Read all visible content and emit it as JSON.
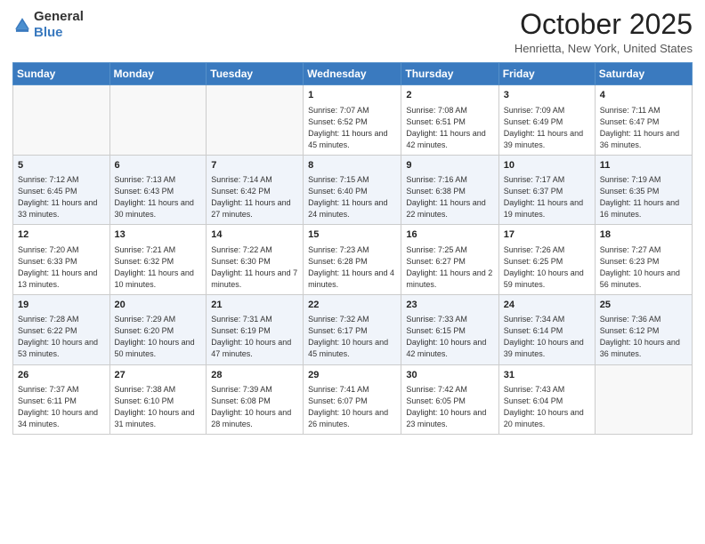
{
  "header": {
    "logo": {
      "general": "General",
      "blue": "Blue"
    },
    "title": "October 2025",
    "location": "Henrietta, New York, United States"
  },
  "weekdays": [
    "Sunday",
    "Monday",
    "Tuesday",
    "Wednesday",
    "Thursday",
    "Friday",
    "Saturday"
  ],
  "weeks": [
    [
      {
        "day": "",
        "info": ""
      },
      {
        "day": "",
        "info": ""
      },
      {
        "day": "",
        "info": ""
      },
      {
        "day": "1",
        "info": "Sunrise: 7:07 AM\nSunset: 6:52 PM\nDaylight: 11 hours and 45 minutes."
      },
      {
        "day": "2",
        "info": "Sunrise: 7:08 AM\nSunset: 6:51 PM\nDaylight: 11 hours and 42 minutes."
      },
      {
        "day": "3",
        "info": "Sunrise: 7:09 AM\nSunset: 6:49 PM\nDaylight: 11 hours and 39 minutes."
      },
      {
        "day": "4",
        "info": "Sunrise: 7:11 AM\nSunset: 6:47 PM\nDaylight: 11 hours and 36 minutes."
      }
    ],
    [
      {
        "day": "5",
        "info": "Sunrise: 7:12 AM\nSunset: 6:45 PM\nDaylight: 11 hours and 33 minutes."
      },
      {
        "day": "6",
        "info": "Sunrise: 7:13 AM\nSunset: 6:43 PM\nDaylight: 11 hours and 30 minutes."
      },
      {
        "day": "7",
        "info": "Sunrise: 7:14 AM\nSunset: 6:42 PM\nDaylight: 11 hours and 27 minutes."
      },
      {
        "day": "8",
        "info": "Sunrise: 7:15 AM\nSunset: 6:40 PM\nDaylight: 11 hours and 24 minutes."
      },
      {
        "day": "9",
        "info": "Sunrise: 7:16 AM\nSunset: 6:38 PM\nDaylight: 11 hours and 22 minutes."
      },
      {
        "day": "10",
        "info": "Sunrise: 7:17 AM\nSunset: 6:37 PM\nDaylight: 11 hours and 19 minutes."
      },
      {
        "day": "11",
        "info": "Sunrise: 7:19 AM\nSunset: 6:35 PM\nDaylight: 11 hours and 16 minutes."
      }
    ],
    [
      {
        "day": "12",
        "info": "Sunrise: 7:20 AM\nSunset: 6:33 PM\nDaylight: 11 hours and 13 minutes."
      },
      {
        "day": "13",
        "info": "Sunrise: 7:21 AM\nSunset: 6:32 PM\nDaylight: 11 hours and 10 minutes."
      },
      {
        "day": "14",
        "info": "Sunrise: 7:22 AM\nSunset: 6:30 PM\nDaylight: 11 hours and 7 minutes."
      },
      {
        "day": "15",
        "info": "Sunrise: 7:23 AM\nSunset: 6:28 PM\nDaylight: 11 hours and 4 minutes."
      },
      {
        "day": "16",
        "info": "Sunrise: 7:25 AM\nSunset: 6:27 PM\nDaylight: 11 hours and 2 minutes."
      },
      {
        "day": "17",
        "info": "Sunrise: 7:26 AM\nSunset: 6:25 PM\nDaylight: 10 hours and 59 minutes."
      },
      {
        "day": "18",
        "info": "Sunrise: 7:27 AM\nSunset: 6:23 PM\nDaylight: 10 hours and 56 minutes."
      }
    ],
    [
      {
        "day": "19",
        "info": "Sunrise: 7:28 AM\nSunset: 6:22 PM\nDaylight: 10 hours and 53 minutes."
      },
      {
        "day": "20",
        "info": "Sunrise: 7:29 AM\nSunset: 6:20 PM\nDaylight: 10 hours and 50 minutes."
      },
      {
        "day": "21",
        "info": "Sunrise: 7:31 AM\nSunset: 6:19 PM\nDaylight: 10 hours and 47 minutes."
      },
      {
        "day": "22",
        "info": "Sunrise: 7:32 AM\nSunset: 6:17 PM\nDaylight: 10 hours and 45 minutes."
      },
      {
        "day": "23",
        "info": "Sunrise: 7:33 AM\nSunset: 6:15 PM\nDaylight: 10 hours and 42 minutes."
      },
      {
        "day": "24",
        "info": "Sunrise: 7:34 AM\nSunset: 6:14 PM\nDaylight: 10 hours and 39 minutes."
      },
      {
        "day": "25",
        "info": "Sunrise: 7:36 AM\nSunset: 6:12 PM\nDaylight: 10 hours and 36 minutes."
      }
    ],
    [
      {
        "day": "26",
        "info": "Sunrise: 7:37 AM\nSunset: 6:11 PM\nDaylight: 10 hours and 34 minutes."
      },
      {
        "day": "27",
        "info": "Sunrise: 7:38 AM\nSunset: 6:10 PM\nDaylight: 10 hours and 31 minutes."
      },
      {
        "day": "28",
        "info": "Sunrise: 7:39 AM\nSunset: 6:08 PM\nDaylight: 10 hours and 28 minutes."
      },
      {
        "day": "29",
        "info": "Sunrise: 7:41 AM\nSunset: 6:07 PM\nDaylight: 10 hours and 26 minutes."
      },
      {
        "day": "30",
        "info": "Sunrise: 7:42 AM\nSunset: 6:05 PM\nDaylight: 10 hours and 23 minutes."
      },
      {
        "day": "31",
        "info": "Sunrise: 7:43 AM\nSunset: 6:04 PM\nDaylight: 10 hours and 20 minutes."
      },
      {
        "day": "",
        "info": ""
      }
    ]
  ]
}
